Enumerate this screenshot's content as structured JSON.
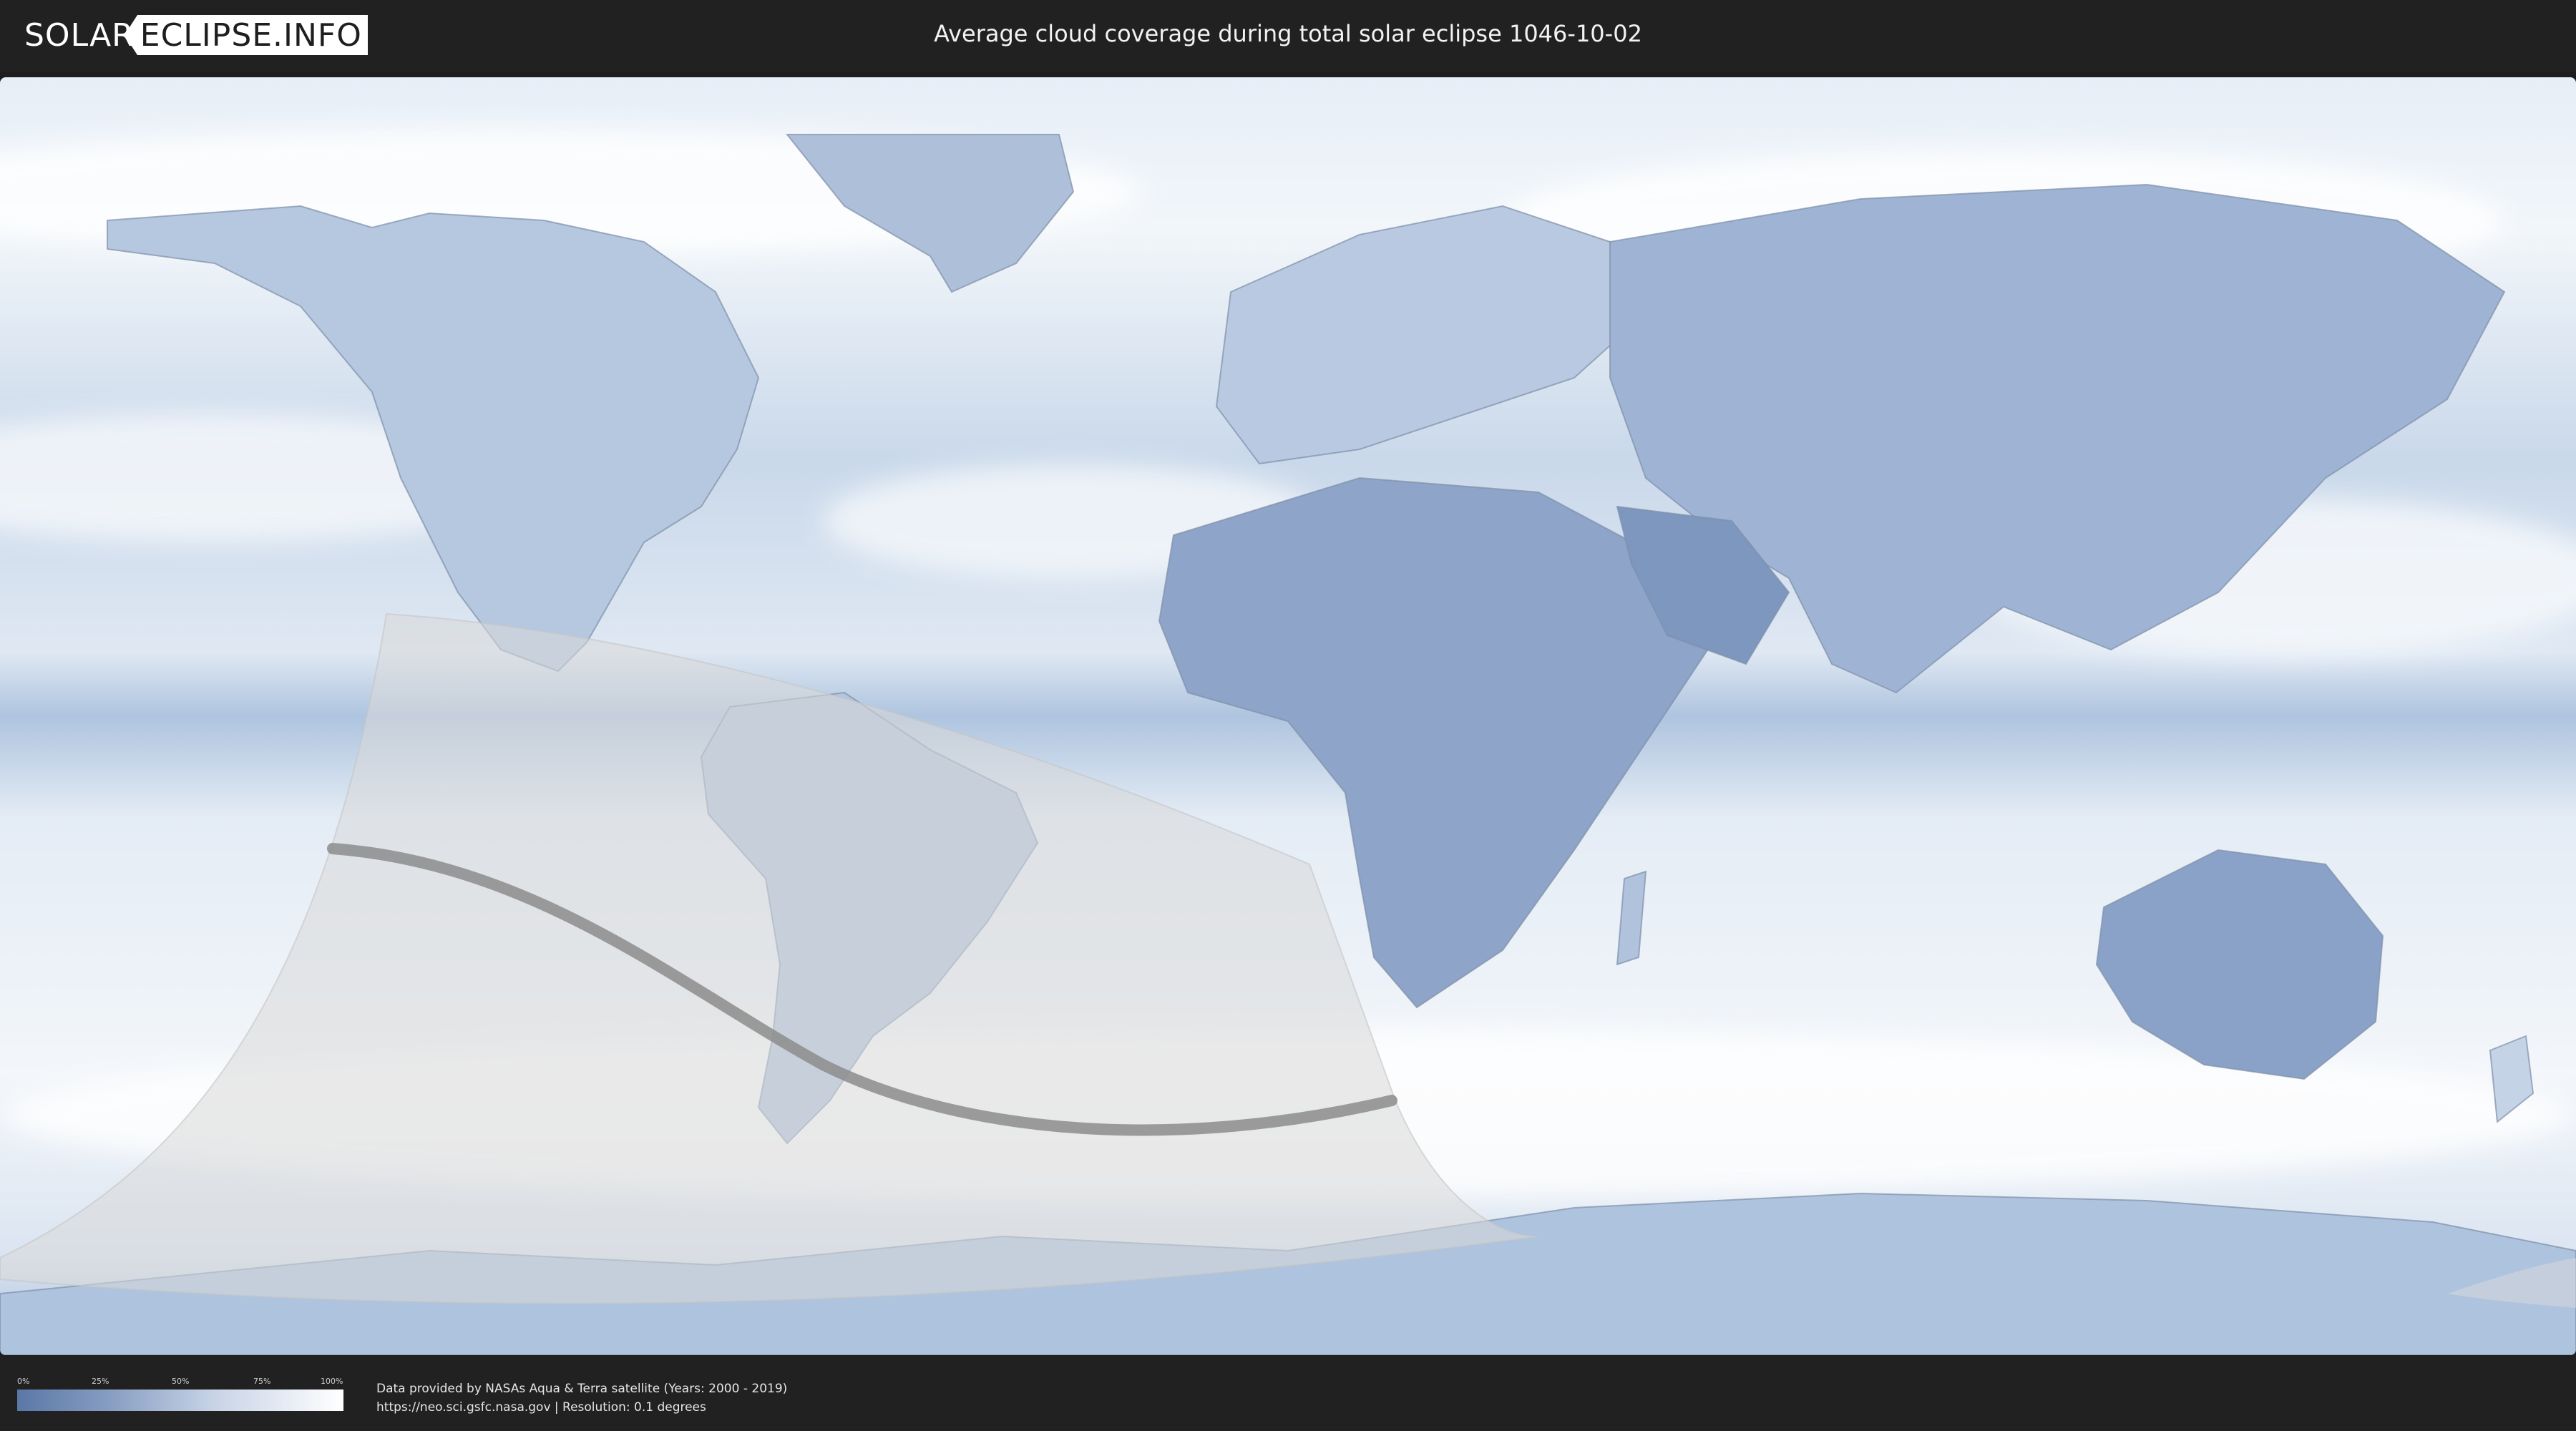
{
  "header": {
    "logo_left": "SOLAR",
    "logo_right": "ECLIPSE.INFO",
    "title": "Average cloud coverage during total solar eclipse 1046-10-02"
  },
  "legend": {
    "ticks": [
      "0%",
      "25%",
      "50%",
      "75%",
      "100%"
    ]
  },
  "footer": {
    "credit_line": "Data provided by NASAs Aqua & Terra satellite (Years: 2000 - 2019)",
    "source_line": "https://neo.sci.gsfc.nasa.gov | Resolution: 0.1 degrees"
  },
  "colors": {
    "header_bg": "#212121",
    "cloud_clear": "#5a77a6",
    "cloud_full": "#ffffff",
    "shadow_zone": "#d9d9d9",
    "eclipse_path": "#8c8c8c"
  },
  "icons": {
    "logo_mark": "eclipse-logo-icon"
  }
}
